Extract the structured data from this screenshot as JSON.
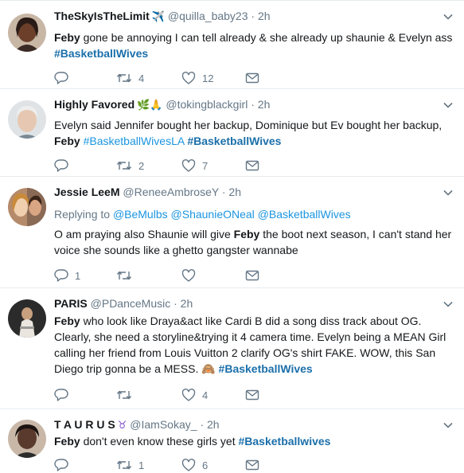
{
  "tweets": [
    {
      "name": "TheSkyIsTheLimit",
      "badge": "✈️",
      "handle": "@quilla_baby23",
      "time": "2h",
      "segments": [
        {
          "t": "Feby",
          "k": "b"
        },
        {
          "t": " gone be annoying I can tell already & she already up shaunie & Evelyn ass ",
          "k": "n"
        },
        {
          "t": "#BasketballWives",
          "k": "hs"
        }
      ],
      "replies": "",
      "retweets": "4",
      "likes": "12"
    },
    {
      "name": "Highly Favored",
      "badge": "🌿🙏",
      "handle": "@tokingblackgirl",
      "time": "2h",
      "segments": [
        {
          "t": "Evelyn said Jennifer bought her backup, Dominique but Ev bought her backup, ",
          "k": "n"
        },
        {
          "t": "Feby",
          "k": "b"
        },
        {
          "t": " ",
          "k": "n"
        },
        {
          "t": "#BasketballWivesLA",
          "k": "h"
        },
        {
          "t": " ",
          "k": "n"
        },
        {
          "t": "#BasketballWives",
          "k": "hs"
        }
      ],
      "replies": "",
      "retweets": "2",
      "likes": "7"
    },
    {
      "name": "Jessie LeeM",
      "badge": "",
      "handle": "@ReneeAmbroseY",
      "time": "2h",
      "replying_label": "Replying to",
      "replying_to": [
        "@BeMulbs",
        "@ShaunieONeal",
        "@BasketballWives"
      ],
      "segments": [
        {
          "t": "O am praying also Shaunie will give ",
          "k": "n"
        },
        {
          "t": "Feby",
          "k": "b"
        },
        {
          "t": " the boot next season, I can't stand her voice she sounds like a ghetto gangster wannabe",
          "k": "n"
        }
      ],
      "replies": "1",
      "retweets": "",
      "likes": ""
    },
    {
      "name": "PARIS",
      "badge": "",
      "handle": "@PDanceMusic",
      "time": "2h",
      "segments": [
        {
          "t": "Feby",
          "k": "b"
        },
        {
          "t": " who look like Draya&act like Cardi B did a song diss track about OG. Clearly, she need a storyline&trying it 4 camera time. Evelyn being a MEAN Girl calling her friend from Louis Vuitton 2 clarify OG's shirt FAKE. WOW, this San Diego trip gonna be a MESS. 🙈 ",
          "k": "n"
        },
        {
          "t": "#BasketballWives",
          "k": "hs"
        }
      ],
      "replies": "",
      "retweets": "",
      "likes": "4"
    },
    {
      "name": "T A U R U S",
      "badge": "♉",
      "handle": "@IamSokay_",
      "time": "2h",
      "segments": [
        {
          "t": "Feby",
          "k": "b"
        },
        {
          "t": " don't even know these girls yet  ",
          "k": "n"
        },
        {
          "t": "#Basketballwives",
          "k": "hs"
        }
      ],
      "replies": "",
      "retweets": "1",
      "likes": "6"
    }
  ],
  "colors": {
    "link": "#1b95e0",
    "muted": "#657786",
    "divider": "#e6ecf0"
  },
  "icons": [
    "reply-icon",
    "retweet-icon",
    "like-icon",
    "dm-icon",
    "chevron-down-icon"
  ]
}
